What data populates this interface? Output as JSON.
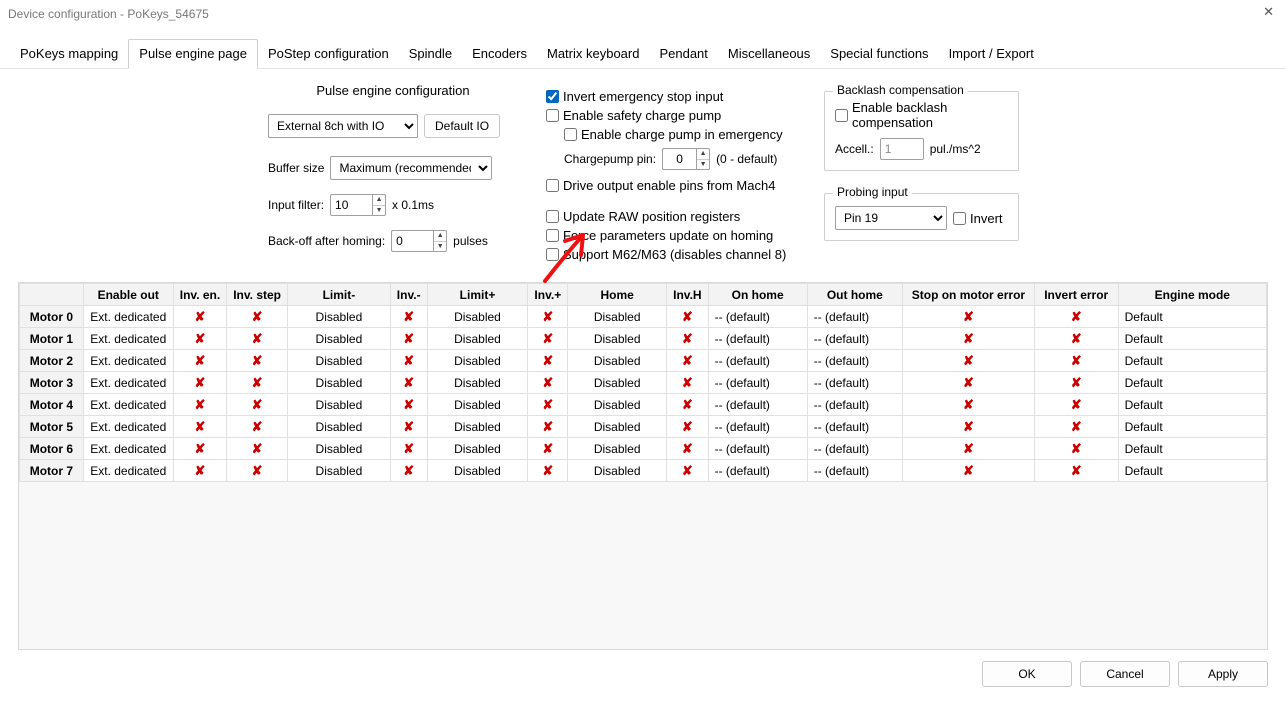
{
  "window": {
    "title": "Device configuration - PoKeys_54675"
  },
  "tabs": [
    "PoKeys mapping",
    "Pulse engine page",
    "PoStep configuration",
    "Spindle",
    "Encoders",
    "Matrix keyboard",
    "Pendant",
    "Miscellaneous",
    "Special functions",
    "Import / Export"
  ],
  "active_tab_index": 1,
  "pulse": {
    "heading": "Pulse engine configuration",
    "engine_type": "External 8ch with IO",
    "default_io_btn": "Default IO",
    "buffer_label": "Buffer size",
    "buffer_value": "Maximum (recommended)",
    "input_filter_label": "Input filter:",
    "input_filter_value": "10",
    "input_filter_unit": "x 0.1ms",
    "backoff_label": "Back-off after homing:",
    "backoff_value": "0",
    "backoff_unit": "pulses"
  },
  "mid": {
    "invert_estop": {
      "label": "Invert emergency stop input",
      "checked": true
    },
    "safety_pump": {
      "label": "Enable safety charge pump",
      "checked": false
    },
    "pump_emerg": {
      "label": "Enable charge pump in emergency",
      "checked": false
    },
    "chargepin_label": "Chargepump pin:",
    "chargepin_value": "0",
    "chargepin_note": "(0 - default)",
    "drive_enable": {
      "label": "Drive output enable pins from Mach4",
      "checked": false
    },
    "update_raw": {
      "label": "Update RAW position registers",
      "checked": false
    },
    "force_params": {
      "label": "Force parameters update on homing",
      "checked": false
    },
    "m62": {
      "label": "Support M62/M63 (disables channel 8)",
      "checked": false
    }
  },
  "backlash": {
    "legend": "Backlash compensation",
    "enable": {
      "label": "Enable backlash compensation",
      "checked": false
    },
    "accel_label": "Accell.:",
    "accel_value": "1",
    "accel_unit": "pul./ms^2"
  },
  "probe": {
    "legend": "Probing input",
    "value": "Pin 19",
    "invert": {
      "label": "Invert",
      "checked": false
    }
  },
  "table": {
    "headers": [
      "Enable out",
      "Inv. en.",
      "Inv. step",
      "Limit-",
      "Inv.-",
      "Limit+",
      "Inv.+",
      "Home",
      "Inv.H",
      "On home",
      "Out home",
      "Stop on motor error",
      "Invert error",
      "Engine mode"
    ],
    "rows": [
      {
        "name": "Motor 0",
        "enable": "Ext. dedicated",
        "limm": "Disabled",
        "limp": "Disabled",
        "home": "Disabled",
        "onhome": "-- (default)",
        "outhome": "-- (default)",
        "mode": "Default"
      },
      {
        "name": "Motor 1",
        "enable": "Ext. dedicated",
        "limm": "Disabled",
        "limp": "Disabled",
        "home": "Disabled",
        "onhome": "-- (default)",
        "outhome": "-- (default)",
        "mode": "Default"
      },
      {
        "name": "Motor 2",
        "enable": "Ext. dedicated",
        "limm": "Disabled",
        "limp": "Disabled",
        "home": "Disabled",
        "onhome": "-- (default)",
        "outhome": "-- (default)",
        "mode": "Default"
      },
      {
        "name": "Motor 3",
        "enable": "Ext. dedicated",
        "limm": "Disabled",
        "limp": "Disabled",
        "home": "Disabled",
        "onhome": "-- (default)",
        "outhome": "-- (default)",
        "mode": "Default"
      },
      {
        "name": "Motor 4",
        "enable": "Ext. dedicated",
        "limm": "Disabled",
        "limp": "Disabled",
        "home": "Disabled",
        "onhome": "-- (default)",
        "outhome": "-- (default)",
        "mode": "Default"
      },
      {
        "name": "Motor 5",
        "enable": "Ext. dedicated",
        "limm": "Disabled",
        "limp": "Disabled",
        "home": "Disabled",
        "onhome": "-- (default)",
        "outhome": "-- (default)",
        "mode": "Default"
      },
      {
        "name": "Motor 6",
        "enable": "Ext. dedicated",
        "limm": "Disabled",
        "limp": "Disabled",
        "home": "Disabled",
        "onhome": "-- (default)",
        "outhome": "-- (default)",
        "mode": "Default"
      },
      {
        "name": "Motor 7",
        "enable": "Ext. dedicated",
        "limm": "Disabled",
        "limp": "Disabled",
        "home": "Disabled",
        "onhome": "-- (default)",
        "outhome": "-- (default)",
        "mode": "Default"
      }
    ]
  },
  "footer": {
    "ok": "OK",
    "cancel": "Cancel",
    "apply": "Apply"
  }
}
